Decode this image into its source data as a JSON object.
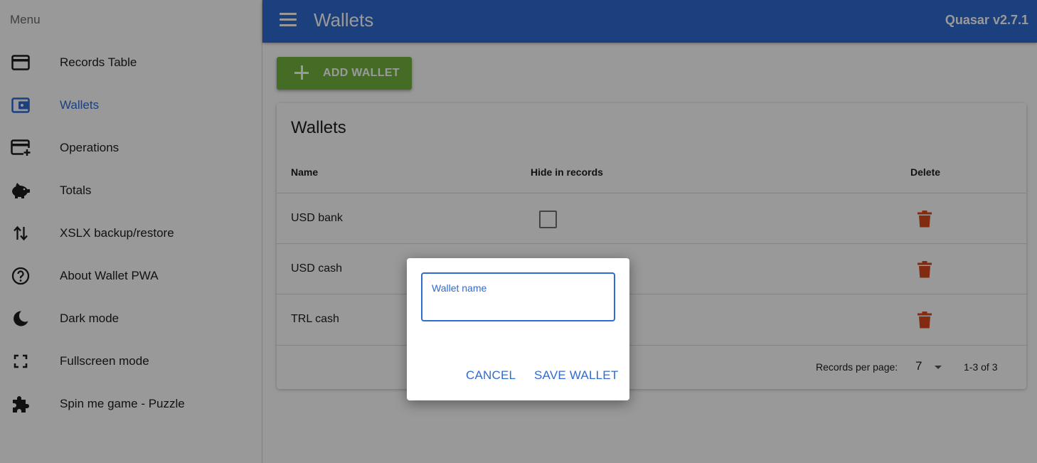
{
  "drawer": {
    "header": "Menu",
    "items": [
      {
        "label": "Records Table",
        "icon": "credit-card-icon"
      },
      {
        "label": "Wallets",
        "icon": "wallet-icon"
      },
      {
        "label": "Operations",
        "icon": "add-card-icon"
      },
      {
        "label": "Totals",
        "icon": "piggy-bank-icon"
      },
      {
        "label": "XSLX backup/restore",
        "icon": "swap-vert-icon"
      },
      {
        "label": "About Wallet PWA",
        "icon": "help-circle-icon"
      },
      {
        "label": "Dark mode",
        "icon": "moon-icon"
      },
      {
        "label": "Fullscreen mode",
        "icon": "fullscreen-icon"
      },
      {
        "label": "Spin me game - Puzzle",
        "icon": "puzzle-icon"
      }
    ],
    "active_item": "Wallets"
  },
  "header": {
    "title": "Wallets",
    "version": "Quasar v2.7.1"
  },
  "toolbar": {
    "add_wallet_label": "ADD WALLET"
  },
  "table": {
    "title": "Wallets",
    "columns": {
      "name": "Name",
      "hide": "Hide in records",
      "delete": "Delete"
    },
    "rows": [
      {
        "name": "USD bank",
        "hide_in_records": false
      },
      {
        "name": "USD cash",
        "hide_in_records": false
      },
      {
        "name": "TRL cash",
        "hide_in_records": false
      }
    ],
    "footer": {
      "records_per_page_label": "Records per page:",
      "records_per_page_value": "7",
      "pagination": "1-3 of 3"
    }
  },
  "dialog": {
    "field_label": "Wallet name",
    "field_value": "",
    "cancel_label": "CANCEL",
    "save_label": "SAVE WALLET"
  },
  "colors": {
    "primary": "#2f6bd0",
    "positive": "#74b53c",
    "negative": "#d9481c"
  }
}
